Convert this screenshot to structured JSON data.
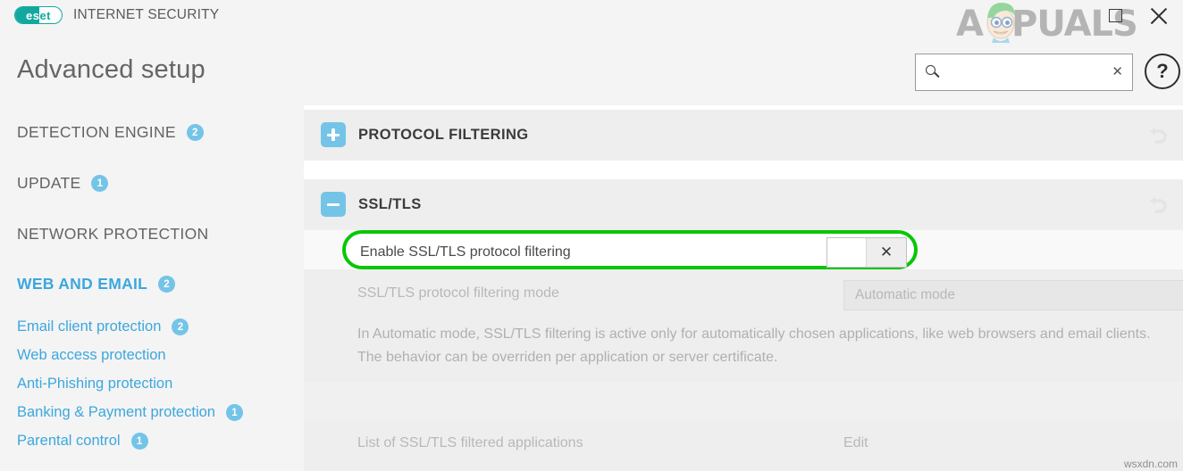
{
  "window": {
    "brand_mark": "eset",
    "suite_name": "INTERNET SECURITY",
    "maximize_icon": "maximize-icon",
    "close_icon": "close-icon",
    "watermark_overlay": "APPUALS",
    "watermark_bottom": "wsxdn.com"
  },
  "page": {
    "title": "Advanced setup"
  },
  "search": {
    "value": "",
    "placeholder": "",
    "clear_label": "✕",
    "icon": "search-icon"
  },
  "help": {
    "label": "?"
  },
  "sidebar": {
    "groups": [
      {
        "label": "DETECTION ENGINE",
        "badge": "2",
        "active": false
      },
      {
        "label": "UPDATE",
        "badge": "1",
        "active": false
      },
      {
        "label": "NETWORK PROTECTION",
        "badge": "",
        "active": false
      },
      {
        "label": "WEB AND EMAIL",
        "badge": "2",
        "active": true
      }
    ],
    "items": [
      {
        "label": "Email client protection",
        "badge": "2"
      },
      {
        "label": "Web access protection",
        "badge": ""
      },
      {
        "label": "Anti-Phishing protection",
        "badge": ""
      },
      {
        "label": "Banking & Payment protection",
        "badge": "1"
      },
      {
        "label": "Parental control",
        "badge": "1"
      }
    ]
  },
  "content": {
    "sections": [
      {
        "title": "PROTOCOL FILTERING",
        "state": "collapsed",
        "toggle_icon": "plus-icon",
        "revert_icon": "revert-icon"
      },
      {
        "title": "SSL/TLS",
        "state": "expanded",
        "toggle_icon": "minus-icon",
        "revert_icon": "revert-icon"
      }
    ],
    "ssl_tls": {
      "enable": {
        "label": "Enable SSL/TLS protocol filtering",
        "toggle_state": "off",
        "toggle_mark": "✕",
        "highlight_color": "#07c706",
        "info_icon": "info-icon"
      },
      "mode": {
        "label": "SSL/TLS protocol filtering mode",
        "value": "Automatic mode",
        "disabled": true,
        "chevron_icon": "chevron-down-icon"
      },
      "description": "In Automatic mode, SSL/TLS filtering is active only for automatically chosen applications, like web browsers and email clients. The behavior can be overriden per application or server certificate.",
      "filtered_apps": {
        "label": "List of SSL/TLS filtered applications",
        "action": "Edit",
        "disabled": true,
        "info_icon": "info-icon"
      }
    }
  },
  "colors": {
    "brand_teal": "#13a89e",
    "accent_blue": "#3ca7dd",
    "badge_blue": "#74c4e8",
    "highlight_green": "#07c706",
    "disabled_grey": "#b8b8b8"
  }
}
